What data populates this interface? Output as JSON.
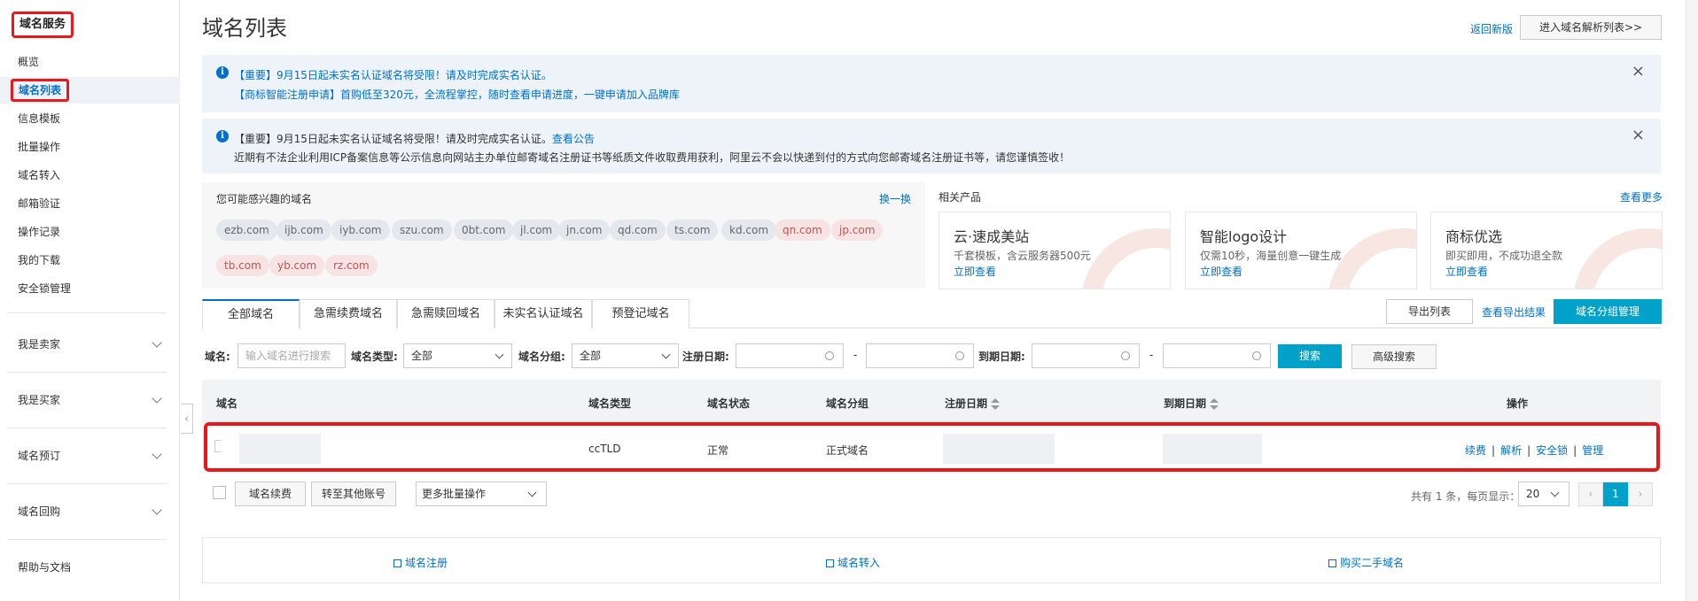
{
  "sidebar": {
    "title": "域名服务",
    "items": [
      {
        "label": "概览"
      },
      {
        "label": "域名列表"
      },
      {
        "label": "信息模板"
      },
      {
        "label": "批量操作"
      },
      {
        "label": "域名转入"
      },
      {
        "label": "邮箱验证"
      },
      {
        "label": "操作记录"
      },
      {
        "label": "我的下载"
      },
      {
        "label": "安全锁管理"
      }
    ],
    "groups": [
      {
        "label": "我是卖家"
      },
      {
        "label": "我是买家"
      },
      {
        "label": "域名预订"
      },
      {
        "label": "域名回购"
      }
    ],
    "help": "帮助与文档",
    "collapse_glyph": "‹"
  },
  "header": {
    "title": "域名列表",
    "back_link": "返回新版",
    "enter_button": "进入域名解析列表>>"
  },
  "notices": [
    {
      "line1": "【重要】9月15日起未实名认证域名将受限！请及时完成实名认证。",
      "line2": "【商标智能注册申请】首购低至320元，全流程掌控，随时查看申请进度，一键申请加入品牌库"
    },
    {
      "line1": "【重要】9月15日起未实名认证域名将受限！请及时完成实名认证。",
      "line1_link": "查看公告",
      "line2": "近期有不法企业利用ICP备案信息等公示信息向网站主办单位邮寄域名注册证书等纸质文件收取费用获利，阿里云不会以快递到付的方式向您邮寄域名注册证书等，请您谨慎签收！"
    }
  ],
  "interest": {
    "heading": "您可能感兴趣的域名",
    "swap": "换一换",
    "domains": [
      "ezb.com",
      "ijb.com",
      "iyb.com",
      "szu.com",
      "0bt.com",
      "jl.com",
      "jn.com",
      "qd.com",
      "ts.com",
      "kd.com",
      "qn.com",
      "jp.com",
      "tb.com",
      "yb.com",
      "rz.com"
    ]
  },
  "related": {
    "heading": "相关产品",
    "more": "查看更多",
    "cards": [
      {
        "title": "云·速成美站",
        "desc": "千套模板，含云服务器500元",
        "link": "立即查看"
      },
      {
        "title": "智能logo设计",
        "desc": "仅需10秒，海量创意一键生成",
        "link": "立即查看"
      },
      {
        "title": "商标优选",
        "desc": "即买即用，不成功退全款",
        "link": "立即查看"
      }
    ]
  },
  "tabs": [
    "全部域名",
    "急需续费域名",
    "急需赎回域名",
    "未实名认证域名",
    "预登记域名"
  ],
  "actions": {
    "export": "导出列表",
    "export_result": "查看导出结果",
    "group_manage": "域名分组管理"
  },
  "filter": {
    "domain_label": "域名:",
    "domain_placeholder": "输入域名进行搜索",
    "type_label": "域名类型:",
    "type_value": "全部",
    "group_label": "域名分组:",
    "group_value": "全部",
    "reg_label": "注册日期:",
    "exp_label": "到期日期:",
    "dash": "-",
    "search": "搜索",
    "advanced": "高级搜索"
  },
  "table": {
    "columns": [
      "域名",
      "域名类型",
      "域名状态",
      "域名分组",
      "注册日期",
      "到期日期",
      "操作"
    ],
    "rows": [
      {
        "type": "ccTLD",
        "status": "正常",
        "group": "正式域名",
        "ops": [
          "续费",
          "解析",
          "安全锁",
          "管理"
        ]
      }
    ]
  },
  "bottom": {
    "renew": "域名续费",
    "transfer": "转至其他账号",
    "batch": "更多批量操作",
    "total": "共有 1 条，每页显示：",
    "page_size": "20",
    "prev": "‹",
    "page": "1",
    "next": "›"
  },
  "footer": {
    "register": "域名注册",
    "transfer_in": "域名转入",
    "buy": "购买二手域名"
  }
}
